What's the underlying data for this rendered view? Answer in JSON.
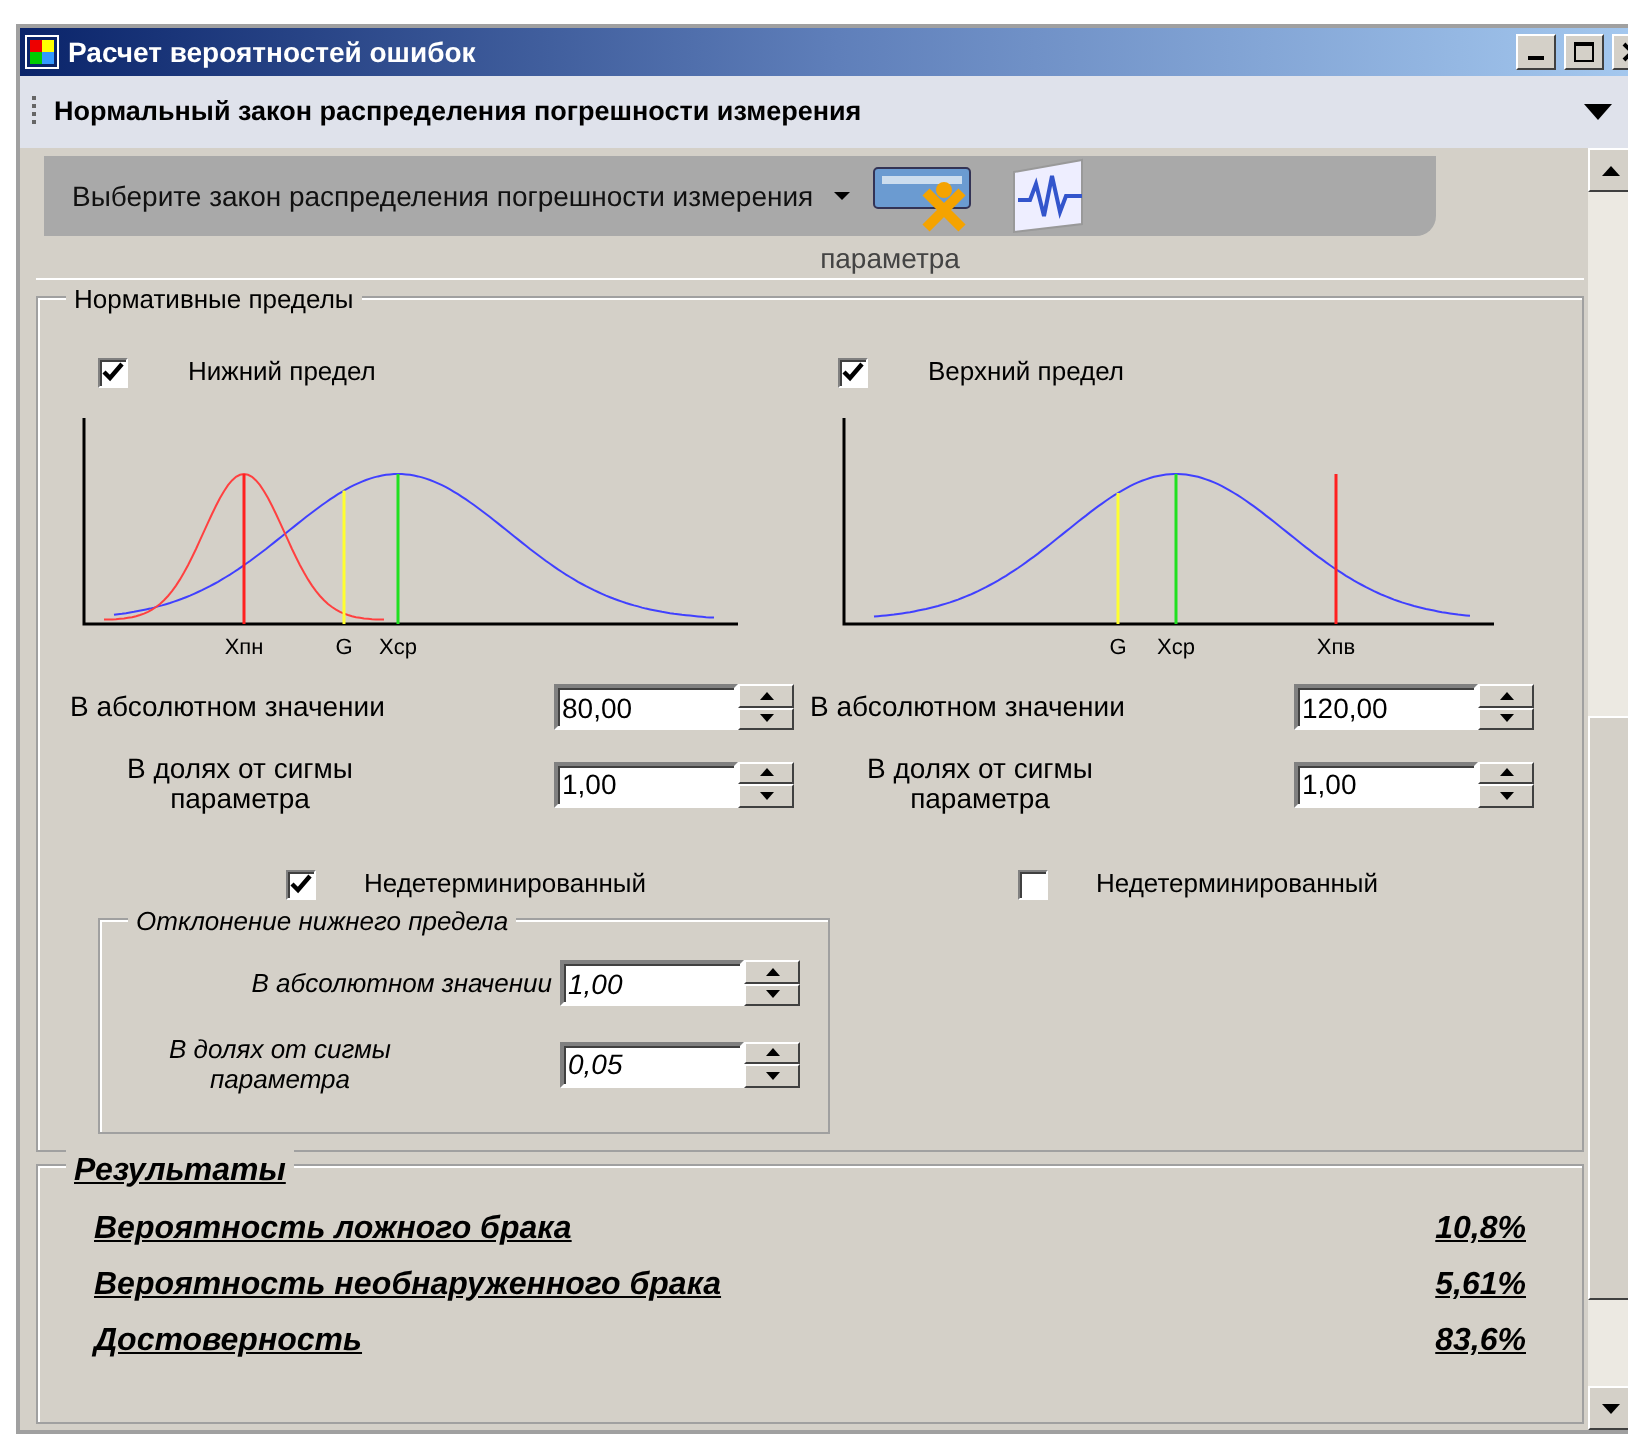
{
  "window": {
    "title": "Расчет вероятностей ошибок"
  },
  "toolbar": {
    "title": "Нормальный закон распределения погрешности измерения"
  },
  "dropdown": {
    "text": "Выберите закон распределения погрешности измерения"
  },
  "partial_label": "параметра",
  "limits": {
    "title": "Нормативные пределы",
    "sides": [
      {
        "label": "Нижний предел",
        "checked": true,
        "limit_curve": true,
        "markers": [
          {
            "label": "Xпн",
            "kind": "limit"
          },
          {
            "label": "G",
            "kind": "guard"
          },
          {
            "label": "Xср",
            "kind": "mean"
          }
        ],
        "absolute": {
          "label": "В абсолютном значении",
          "value": "80,00"
        },
        "sigma": {
          "label": "В долях от сигмы параметра",
          "value": "1,00"
        },
        "nondeterministic": {
          "label": "Недетерминированный",
          "checked": true
        }
      },
      {
        "label": "Верхний предел",
        "checked": true,
        "limit_curve": false,
        "markers": [
          {
            "label": "G",
            "kind": "guard"
          },
          {
            "label": "Xср",
            "kind": "mean"
          },
          {
            "label": "Xпв",
            "kind": "limit"
          }
        ],
        "absolute": {
          "label": "В абсолютном значении",
          "value": "120,00"
        },
        "sigma": {
          "label": "В долях от сигмы параметра",
          "value": "1,00"
        },
        "nondeterministic": {
          "label": "Недетерминированный",
          "checked": false
        }
      }
    ],
    "deviation": {
      "title": "Отклонение нижнего предела",
      "absolute": {
        "label": "В абсолютном значении",
        "value": "1,00"
      },
      "sigma": {
        "label": "В долях от сигмы параметра",
        "value": "0,05"
      }
    }
  },
  "results": {
    "title": "Результаты",
    "rows": [
      {
        "label": "Вероятность ложного брака",
        "value": "10,8%"
      },
      {
        "label": "Вероятность необнаруженного брака",
        "value": "5,61%"
      },
      {
        "label": "Достоверность",
        "value": "83,6%"
      }
    ]
  }
}
